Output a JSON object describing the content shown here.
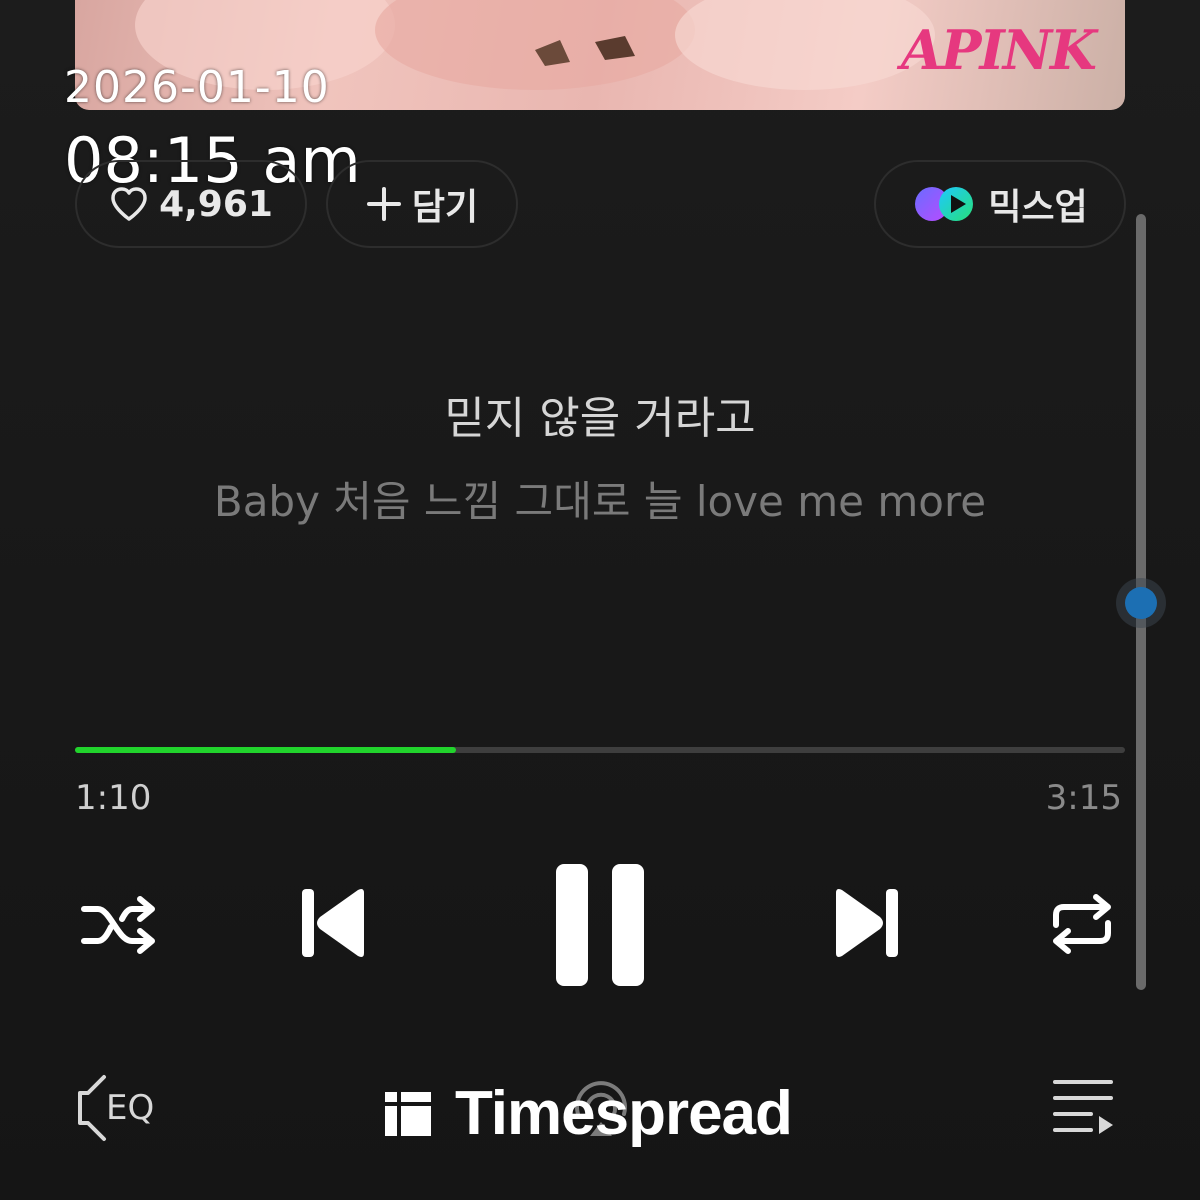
{
  "album": {
    "logo_text": "APINK"
  },
  "stamp": {
    "date": "2026-01-10",
    "time": "08:15 am"
  },
  "actions": {
    "like_count": "4,961",
    "add_label": "담기",
    "mixup_label": "믹스업"
  },
  "lyrics": {
    "current": "믿지 않을 거라고",
    "next": "Baby 처음 느낌 그대로 늘 love me more"
  },
  "player": {
    "elapsed": "1:10",
    "total": "3:15",
    "progress": 0.363,
    "state": "playing"
  },
  "controls": {
    "shuffle_icon": "shuffle-icon",
    "prev_icon": "previous-icon",
    "pause_icon": "pause-icon",
    "next_icon": "next-icon",
    "repeat_icon": "repeat-icon"
  },
  "bottom": {
    "eq_label": "EQ",
    "brand": "Timespread",
    "queue_icon": "queue-icon"
  },
  "colors": {
    "progress": "#21d32c",
    "track": "#3e3e3e",
    "background": "#181818",
    "accent_logo": "#e6387f",
    "scroll_dot": "#1c6fb3"
  }
}
